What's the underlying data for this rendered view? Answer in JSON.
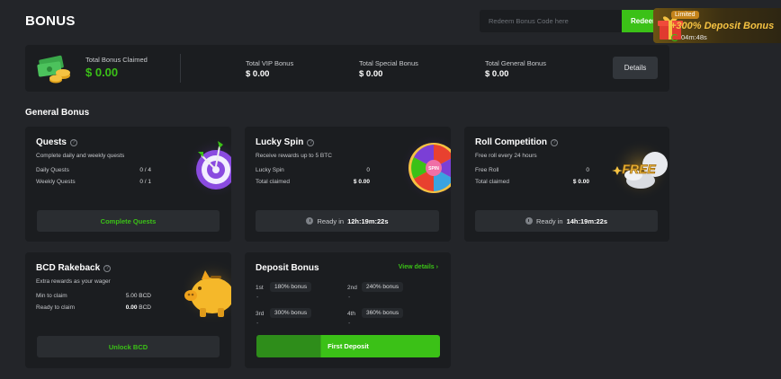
{
  "page": {
    "title": "BONUS"
  },
  "redeem": {
    "placeholder": "Redeem Bonus Code here",
    "button_label": "Redeem"
  },
  "promo": {
    "badge": "Limited",
    "text": "+300% Deposit Bonus",
    "timer": "04m:48s"
  },
  "summary": {
    "total_claimed_label": "Total Bonus Claimed",
    "total_claimed_value": "$ 0.00",
    "items": [
      {
        "label": "Total VIP Bonus",
        "value": "$ 0.00"
      },
      {
        "label": "Total Special Bonus",
        "value": "$ 0.00"
      },
      {
        "label": "Total General Bonus",
        "value": "$ 0.00"
      }
    ],
    "details_label": "Details"
  },
  "section_title": "General Bonus",
  "quests": {
    "title": "Quests",
    "subtitle": "Complete daily and weekly quests",
    "rows": [
      {
        "label": "Daily Quests",
        "value": "0 / 4"
      },
      {
        "label": "Weekly Quests",
        "value": "0 / 1"
      }
    ],
    "button": "Complete Quests"
  },
  "lucky_spin": {
    "title": "Lucky Spin",
    "subtitle": "Receive rewards up to 5 BTC",
    "rows": [
      {
        "label": "Lucky Spin",
        "value": "0"
      },
      {
        "label": "Total claimed",
        "value": "$ 0.00"
      }
    ],
    "ready_label": "Ready in",
    "ready_time": "12h:19m:22s"
  },
  "roll": {
    "title": "Roll Competition",
    "subtitle": "Free roll every 24 hours",
    "rows": [
      {
        "label": "Free Roll",
        "value": "0"
      },
      {
        "label": "Total claimed",
        "value": "$ 0.00"
      }
    ],
    "ready_label": "Ready in",
    "ready_time": "14h:19m:22s",
    "art_text": "FREE"
  },
  "rakeback": {
    "title": "BCD Rakeback",
    "subtitle": "Extra rewards as your wager",
    "rows": [
      {
        "label": "Min to claim",
        "value": "5.00 BCD"
      },
      {
        "label": "Ready to claim",
        "value_bold": "0.00",
        "value_unit": "BCD"
      }
    ],
    "button": "Unlock BCD"
  },
  "deposit": {
    "title": "Deposit Bonus",
    "view_details": "View details",
    "tiers": [
      {
        "rank": "1st",
        "bonus": "180% bonus"
      },
      {
        "rank": "2nd",
        "bonus": "240% bonus"
      },
      {
        "rank": "3rd",
        "bonus": "300% bonus"
      },
      {
        "rank": "4th",
        "bonus": "360% bonus"
      }
    ],
    "dash": "-",
    "button": "First Deposit"
  },
  "colors": {
    "accent": "#3bc117",
    "card": "#1b1d20",
    "background": "#232529"
  },
  "icons": [
    "money-stack-icon",
    "gift-icon",
    "help-icon",
    "dart-target-icon",
    "spin-wheel-icon",
    "free-coins-icon",
    "piggy-bank-icon",
    "clock-icon",
    "chevron-right-icon"
  ]
}
